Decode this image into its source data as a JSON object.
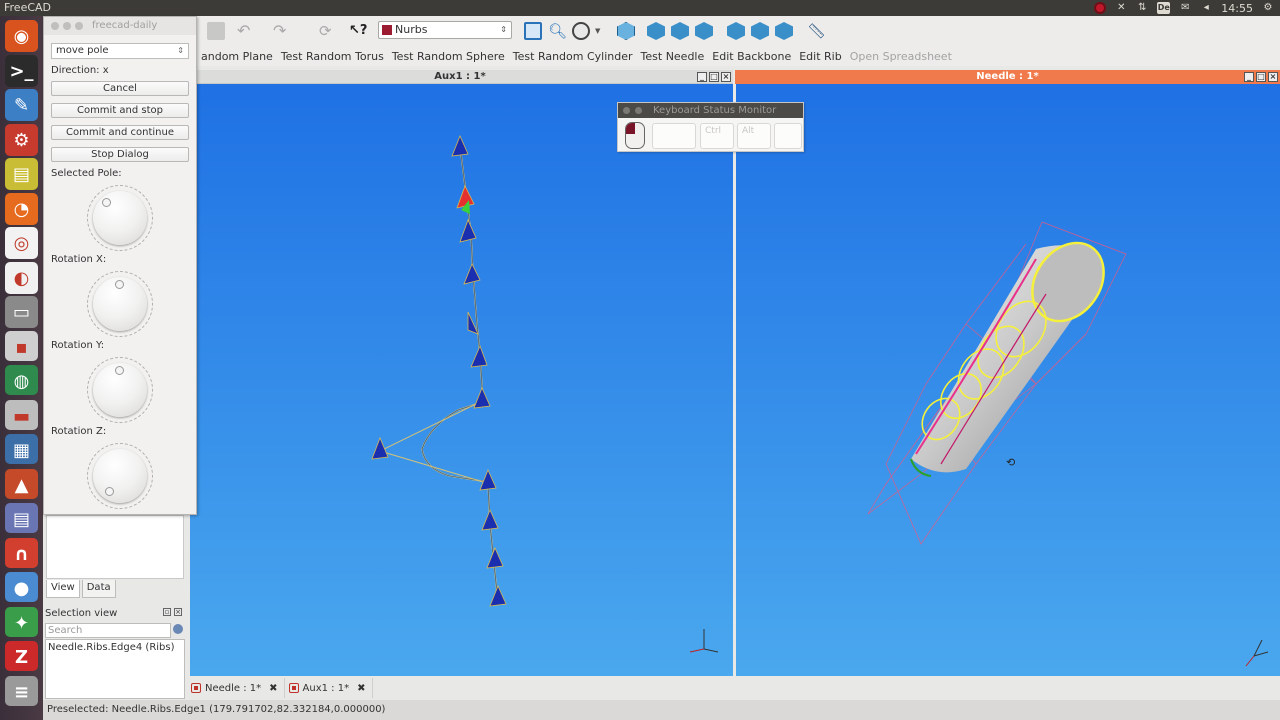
{
  "system": {
    "app_name": "FreeCAD",
    "clock": "14:55",
    "lang_indicator": "De"
  },
  "launcher": {
    "items": [
      "ubuntu-logo-icon",
      "terminal-icon",
      "browser-icon",
      "settings-icon",
      "ruler-icon",
      "firefox-icon",
      "chrome-icon",
      "blender-icon",
      "files-icon",
      "app-icon",
      "app-icon",
      "app-icon",
      "app-icon",
      "app-icon",
      "app-icon",
      "app-icon",
      "app-icon",
      "app-icon",
      "app-icon",
      "app-icon"
    ]
  },
  "toolbar": {
    "workbench": "Nurbs"
  },
  "commands": [
    {
      "label": "andom Plane",
      "enabled": true
    },
    {
      "label": "Test Random Torus",
      "enabled": true
    },
    {
      "label": "Test Random Sphere",
      "enabled": true
    },
    {
      "label": "Test Random Cylinder",
      "enabled": true
    },
    {
      "label": "Test Needle",
      "enabled": true
    },
    {
      "label": "Edit Backbone",
      "enabled": true
    },
    {
      "label": "Edit Rib",
      "enabled": true
    },
    {
      "label": "Open Spreadsheet",
      "enabled": false
    }
  ],
  "views": {
    "aux_title": "Aux1 : 1*",
    "needle_title": "Needle : 1*"
  },
  "view_tabs": [
    {
      "label": "Needle : 1*"
    },
    {
      "label": "Aux1 : 1*"
    }
  ],
  "dialog": {
    "title": "freecad-daily",
    "mode": "move pole",
    "direction": "Direction: x",
    "cancel": "Cancel",
    "commit_stop": "Commit and stop",
    "commit_continue": "Commit and continue",
    "stop_dialog": "Stop Dialog",
    "selected_pole": "Selected  Pole:",
    "rotation_x": "Rotation X:",
    "rotation_y": "Rotation Y:",
    "rotation_z": "Rotation Z:"
  },
  "combo": {
    "tab_view": "View",
    "tab_data": "Data",
    "selection_title": "Selection view",
    "search_placeholder": "Search",
    "selection_item": "Needle.Ribs.Edge4 (Ribs)"
  },
  "keyboard_monitor": {
    "title": "Keyboard Status Monitor",
    "keys": [
      "",
      "Ctrl",
      "Alt",
      ""
    ]
  },
  "status": {
    "text": "Preselected: Needle.Ribs.Edge1 (179.791702,82.332184,0.000000)"
  },
  "colors": {
    "view_top": "#1f71e4",
    "view_bottom": "#4aa8ee",
    "active_title": "#f07a4b",
    "curve": "#e8318c",
    "rib": "#f5f03c"
  }
}
